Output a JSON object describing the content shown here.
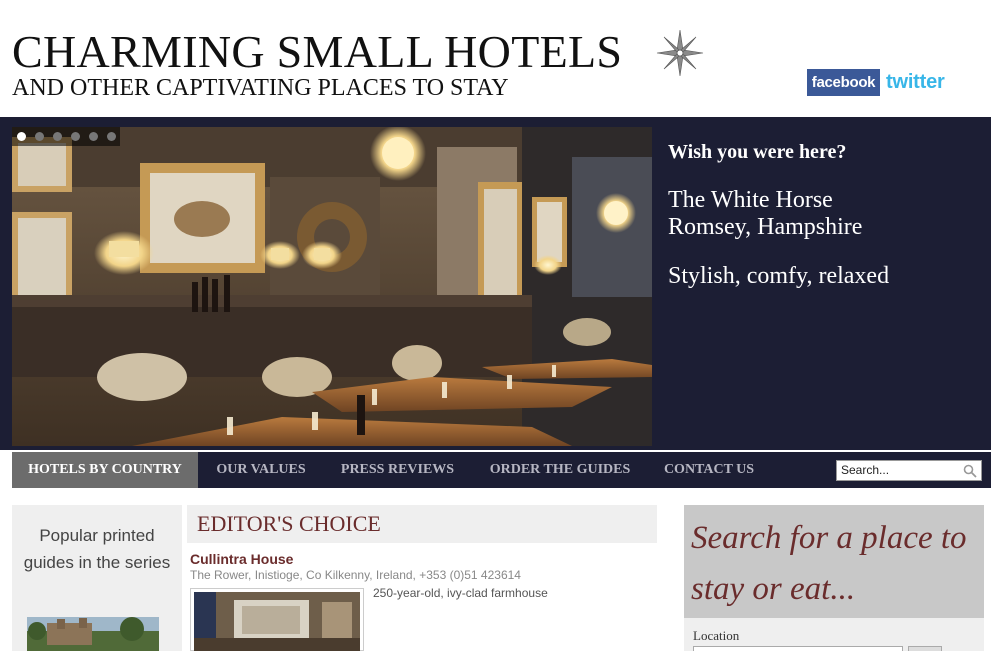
{
  "header": {
    "title": "CHARMING SMALL HOTELS",
    "subtitle": "AND OTHER CAPTIVATING PLACES TO STAY",
    "logo_icon": "compass-rose-icon",
    "social": {
      "facebook": "facebook",
      "twitter": "twitter"
    }
  },
  "hero": {
    "kicker": "Wish you were here?",
    "lines": [
      "The White Horse",
      "Romsey, Hampshire",
      "Stylish, comfy, relaxed"
    ],
    "slides_total": 6,
    "active_slide": 1
  },
  "nav": {
    "items": [
      {
        "label": "HOTELS BY COUNTRY",
        "active": true
      },
      {
        "label": "OUR VALUES",
        "active": false
      },
      {
        "label": "PRESS REVIEWS",
        "active": false
      },
      {
        "label": "ORDER THE GUIDES",
        "active": false
      },
      {
        "label": "CONTACT US",
        "active": false
      }
    ],
    "search_value": "Search..."
  },
  "left": {
    "popular_text": "Popular printed guides in the series"
  },
  "editors_choice": {
    "heading": "EDITOR'S CHOICE",
    "hotel_name": "Cullintra House",
    "address": "The Rower, Inistioge, Co Kilkenny, Ireland, +353 (0)51 423614",
    "description": "250-year-old, ivy-clad farmhouse"
  },
  "search_panel": {
    "title": "Search for a place to stay or eat...",
    "location_label": "Location"
  },
  "colors": {
    "navy": "#1c1e34",
    "burgundy": "#6a2c2c",
    "facebook_blue": "#3b5998",
    "twitter_blue": "#38b6e8"
  }
}
